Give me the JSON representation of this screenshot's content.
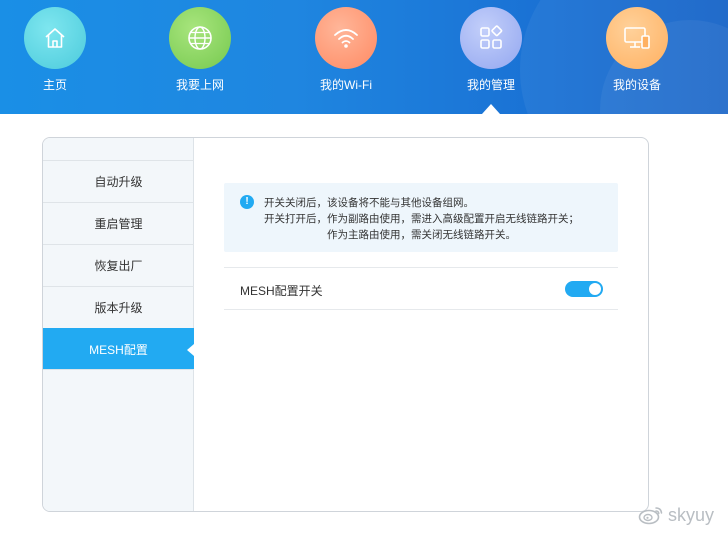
{
  "nav": {
    "items": [
      {
        "label": "主页",
        "icon": "home-icon",
        "color": "#5fd6e4"
      },
      {
        "label": "我要上网",
        "icon": "globe-icon",
        "color": "#8fd66a"
      },
      {
        "label": "我的Wi-Fi",
        "icon": "wifi-icon",
        "color": "#ff9e80"
      },
      {
        "label": "我的管理",
        "icon": "grid-apps-icon",
        "color": "#a9b9f5",
        "active": true
      },
      {
        "label": "我的设备",
        "icon": "devices-icon",
        "color": "#ffc27a"
      }
    ]
  },
  "sidebar": {
    "items": [
      {
        "label": "自动升级"
      },
      {
        "label": "重启管理"
      },
      {
        "label": "恢复出厂"
      },
      {
        "label": "版本升级"
      },
      {
        "label": "MESH配置",
        "active": true
      }
    ]
  },
  "notice": {
    "icon": "info-icon",
    "lines": [
      "开关关闭后，该设备将不能与其他设备组网。",
      "开关打开后，作为副路由使用，需进入高级配置开启无线链路开关；",
      "作为主路由使用，需关闭无线链路开关。"
    ]
  },
  "mesh_row": {
    "label": "MESH配置开关",
    "toggle_on": true
  },
  "watermark": {
    "text": "skyuy",
    "icon": "weibo-icon"
  },
  "colors": {
    "accent": "#22aaf2",
    "topbar": "#1a86e0"
  }
}
